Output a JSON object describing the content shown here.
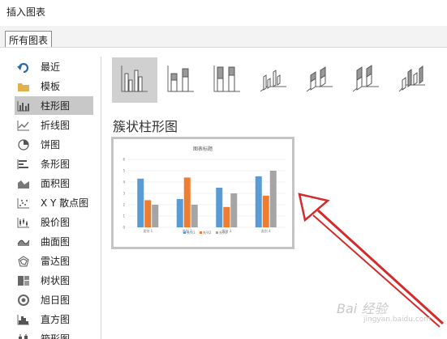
{
  "window": {
    "title": "插入图表"
  },
  "tabs": {
    "all_charts": "所有图表"
  },
  "sidebar": {
    "items": [
      {
        "label": "最近",
        "icon": "undo-arrow-icon"
      },
      {
        "label": "模板",
        "icon": "folder-icon"
      },
      {
        "label": "柱形图",
        "icon": "column-chart-icon",
        "selected": true
      },
      {
        "label": "折线图",
        "icon": "line-chart-icon"
      },
      {
        "label": "饼图",
        "icon": "pie-chart-icon"
      },
      {
        "label": "条形图",
        "icon": "bar-chart-icon"
      },
      {
        "label": "面积图",
        "icon": "area-chart-icon"
      },
      {
        "label": "X Y 散点图",
        "icon": "scatter-chart-icon"
      },
      {
        "label": "股价图",
        "icon": "stock-chart-icon"
      },
      {
        "label": "曲面图",
        "icon": "surface-chart-icon"
      },
      {
        "label": "雷达图",
        "icon": "radar-chart-icon"
      },
      {
        "label": "树状图",
        "icon": "treemap-chart-icon"
      },
      {
        "label": "旭日图",
        "icon": "sunburst-chart-icon"
      },
      {
        "label": "直方图",
        "icon": "histogram-chart-icon"
      },
      {
        "label": "箱形图",
        "icon": "box-chart-icon"
      }
    ]
  },
  "subtypes": {
    "selected_title": "簇状柱形图",
    "items": [
      {
        "icon": "clustered-column-icon",
        "selected": true
      },
      {
        "icon": "stacked-column-icon"
      },
      {
        "icon": "100-stacked-column-icon"
      },
      {
        "icon": "3d-clustered-column-icon"
      },
      {
        "icon": "3d-stacked-column-icon"
      },
      {
        "icon": "3d-100-stacked-column-icon"
      },
      {
        "icon": "3d-column-icon"
      }
    ]
  },
  "preview": {
    "chart_data": {
      "type": "bar",
      "title": "图表标题",
      "categories": [
        "类别 1",
        "类别 2",
        "类别 3",
        "类别 4"
      ],
      "series": [
        {
          "name": "系列1",
          "values": [
            4.3,
            2.5,
            3.5,
            4.5
          ],
          "color": "#5b9bd5"
        },
        {
          "name": "系列2",
          "values": [
            2.4,
            4.4,
            1.8,
            2.8
          ],
          "color": "#ed7d31"
        },
        {
          "name": "系列3",
          "values": [
            2,
            2,
            3,
            5
          ],
          "color": "#a5a5a5"
        }
      ],
      "ylim": [
        0,
        6
      ],
      "yticks": [
        0,
        1,
        2,
        3,
        4,
        5,
        6
      ],
      "grid": true,
      "legend": "bottom"
    }
  },
  "watermark": {
    "text": "Bai 经验",
    "url": "jingyan.baidu.com"
  },
  "annotation": {
    "arrow_color": "#d42a2a"
  }
}
